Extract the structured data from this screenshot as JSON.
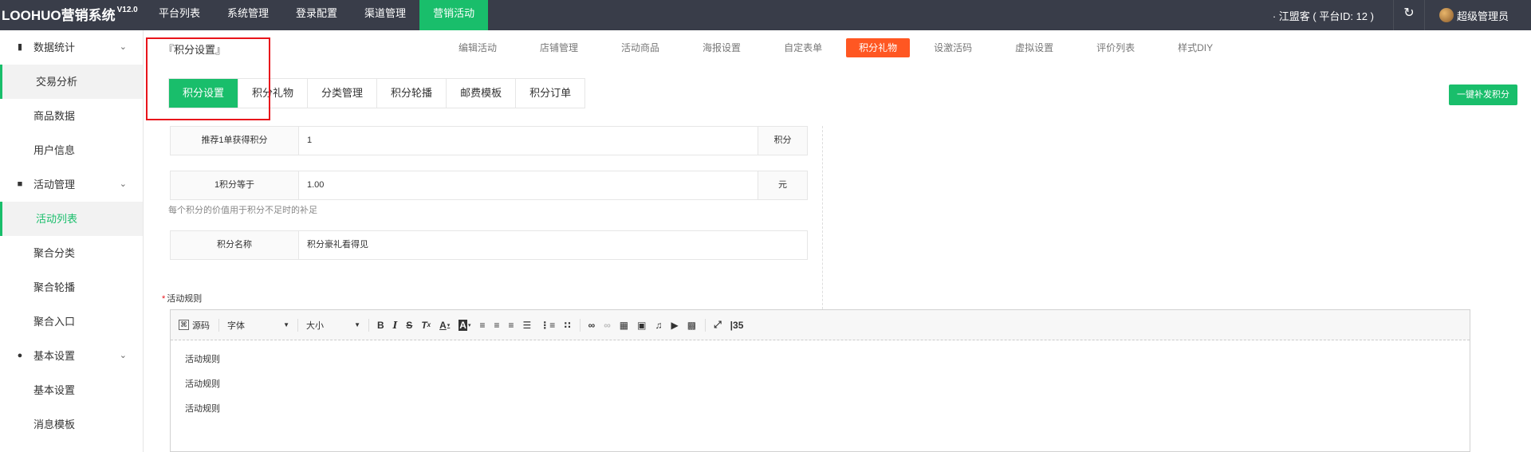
{
  "header": {
    "logo": "LOOHUO营销系统",
    "version": "V12.0",
    "nav": [
      "平台列表",
      "系统管理",
      "登录配置",
      "渠道管理",
      "营销活动"
    ],
    "org": "· 江盟客 ( 平台ID: 12 )",
    "refresh_icon": "↻",
    "user": "超级管理员",
    "user_chevron": "⌄"
  },
  "sidebar": {
    "groups": [
      {
        "icon": "bar-chart-icon",
        "glyph": "▮",
        "label": "数据统计",
        "items": [
          "交易分析",
          "商品数据",
          "用户信息"
        ]
      },
      {
        "icon": "bag-icon",
        "glyph": "■",
        "label": "活动管理",
        "items": [
          "活动列表",
          "聚合分类",
          "聚合轮播",
          "聚合入口"
        ]
      },
      {
        "icon": "gear-icon",
        "glyph": "●",
        "label": "基本设置",
        "items": [
          "基本设置",
          "消息模板"
        ]
      }
    ],
    "chevron": "⌄"
  },
  "main": {
    "breadcrumb": "『积分设置』",
    "subnav": [
      "编辑活动",
      "店铺管理",
      "活动商品",
      "海报设置",
      "自定表单",
      "积分礼物",
      "设激活码",
      "虚拟设置",
      "评价列表",
      "样式DIY"
    ],
    "subnav_active": 5,
    "tabs": [
      "积分设置",
      "积分礼物",
      "分类管理",
      "积分轮播",
      "邮费模板",
      "积分订单"
    ],
    "onekey_label": "一键补发积分",
    "fields": [
      {
        "label": "推荐1单获得积分",
        "value": "1",
        "suffix": "积分"
      },
      {
        "label": "1积分等于",
        "value": "1.00",
        "suffix": "元"
      },
      {
        "label": "积分名称",
        "value": "积分豪礼看得见",
        "suffix": ""
      }
    ],
    "hint": "每个积分的价值用于积分不足时的补足",
    "rule_label": "活动规则",
    "rule_star": "*"
  },
  "editor": {
    "source": "源码",
    "font": "字体",
    "size": "大小",
    "content": [
      "活动规则",
      "活动规则",
      "活动规则"
    ]
  }
}
